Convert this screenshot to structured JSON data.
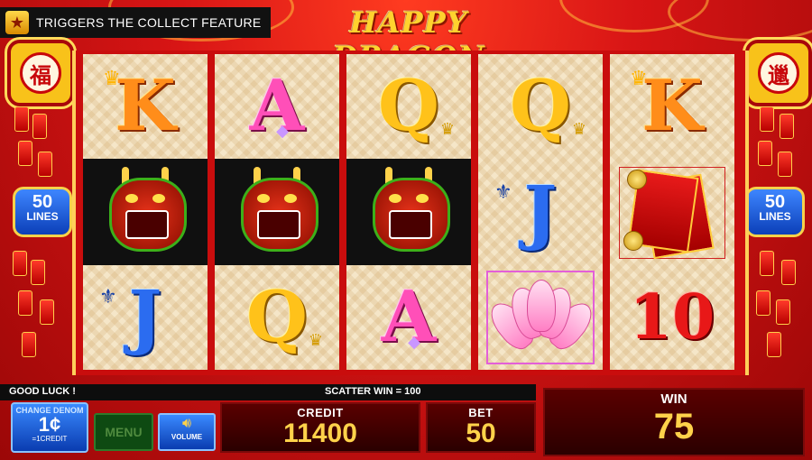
{
  "banner": {
    "text": "TRIGGERS THE COLLECT FEATURE"
  },
  "logo": {
    "text": "HAPPY DRAGON"
  },
  "ornaments": {
    "left_char": "福",
    "right_char": "邋"
  },
  "lines": {
    "left_value": "50",
    "left_label": "LINES",
    "right_value": "50",
    "right_label": "LINES"
  },
  "reels": [
    {
      "top": "K",
      "middle": "dragon",
      "bottom": "J"
    },
    {
      "top": "A",
      "middle": "dragon",
      "bottom": "Q"
    },
    {
      "top": "Q",
      "middle": "dragon",
      "bottom": "A"
    },
    {
      "top": "Q",
      "middle": "J",
      "bottom": "lotus"
    },
    {
      "top": "K",
      "middle": "red-envelope",
      "bottom": "10"
    }
  ],
  "status": {
    "left_message": "GOOD LUCK !",
    "scatter_message": "SCATTER WIN = 100"
  },
  "controls": {
    "denom_title": "CHANGE DENOM",
    "denom_value": "1¢",
    "denom_sub": "=1CREDIT",
    "menu_label": "MENU",
    "volume_label": "VOLUME"
  },
  "meters": {
    "credit_label": "CREDIT",
    "credit_value": "11400",
    "bet_label": "BET",
    "bet_value": "50",
    "win_label": "WIN",
    "win_value": "75"
  },
  "colors": {
    "background": "#c90d0d",
    "gold": "#ffd24a",
    "button_blue": "#0a3cb0"
  }
}
